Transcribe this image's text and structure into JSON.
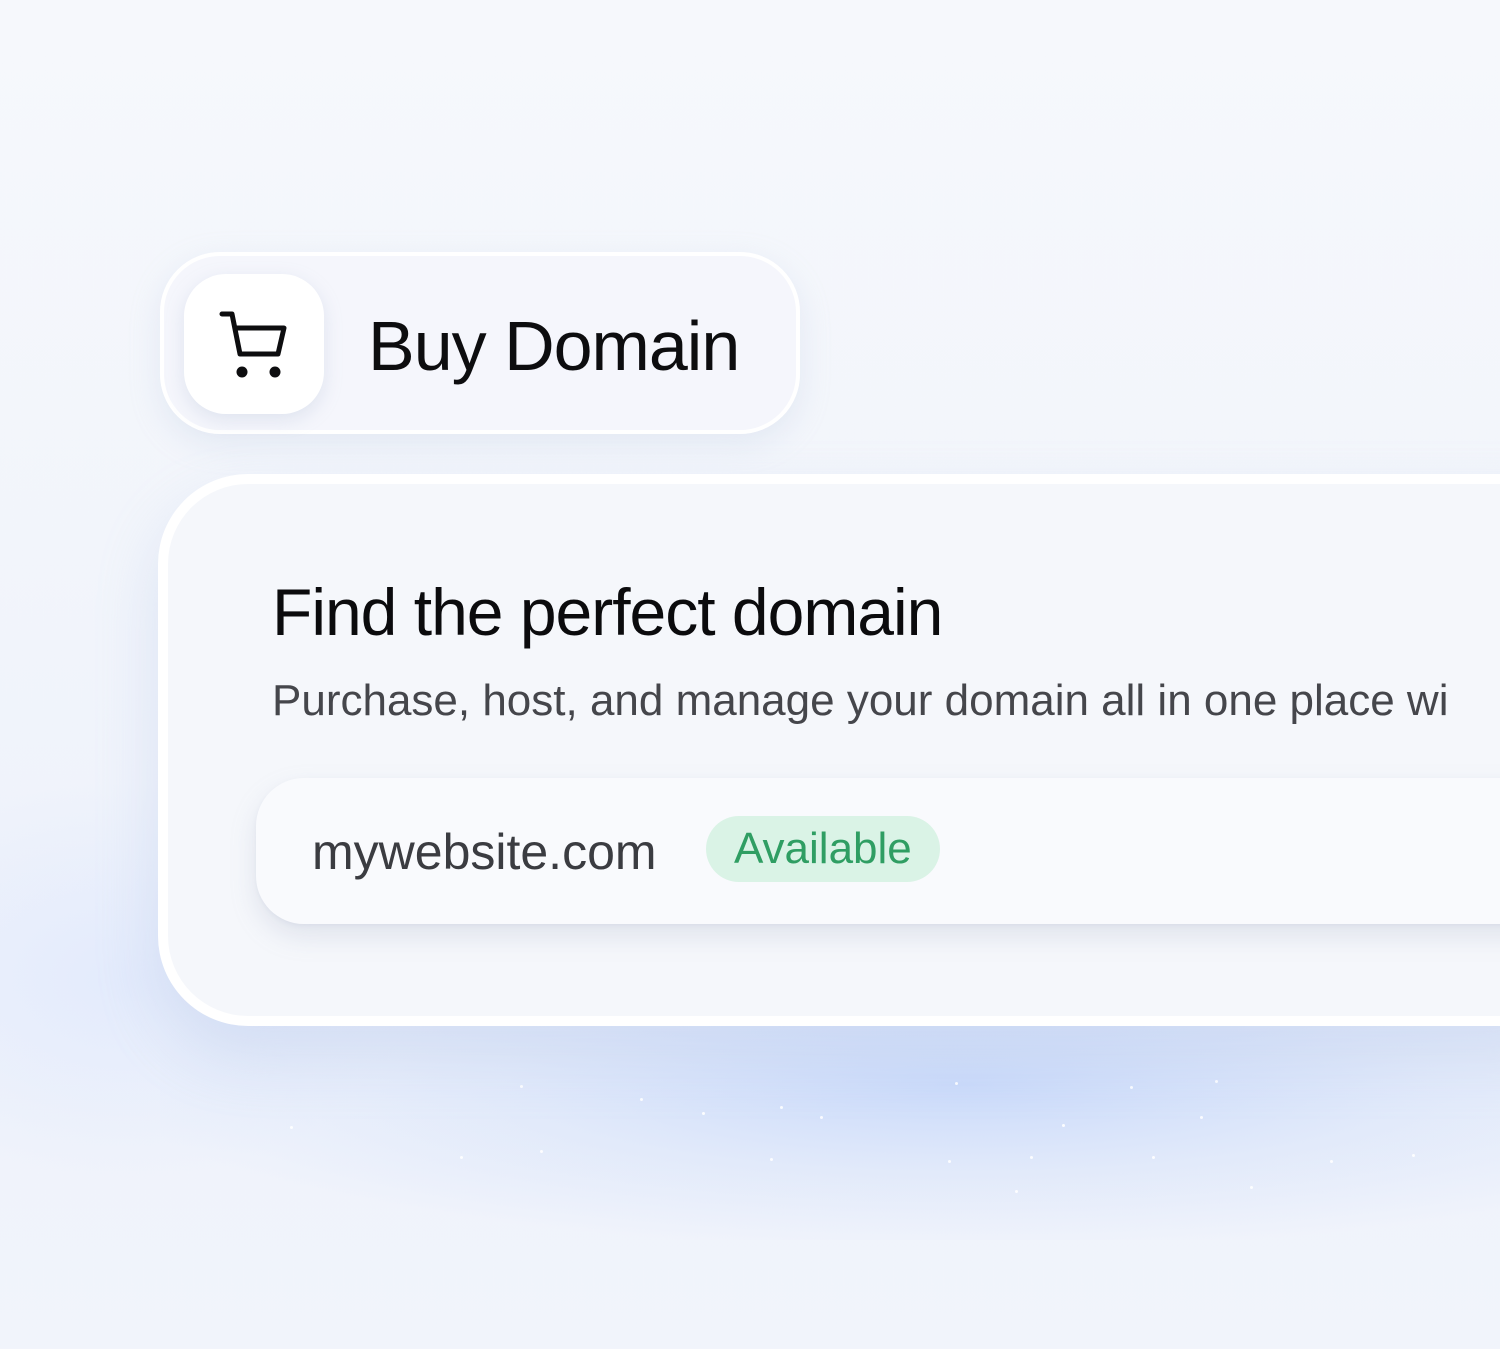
{
  "header": {
    "icon": "shopping-cart-icon",
    "title": "Buy Domain"
  },
  "card": {
    "title": "Find the perfect domain",
    "subtitle": "Purchase, host, and manage your domain all in one place wi"
  },
  "search": {
    "domain": "mywebsite.com",
    "status": "Available"
  },
  "colors": {
    "status_bg": "#daf3e6",
    "status_text": "#2f9e63"
  }
}
